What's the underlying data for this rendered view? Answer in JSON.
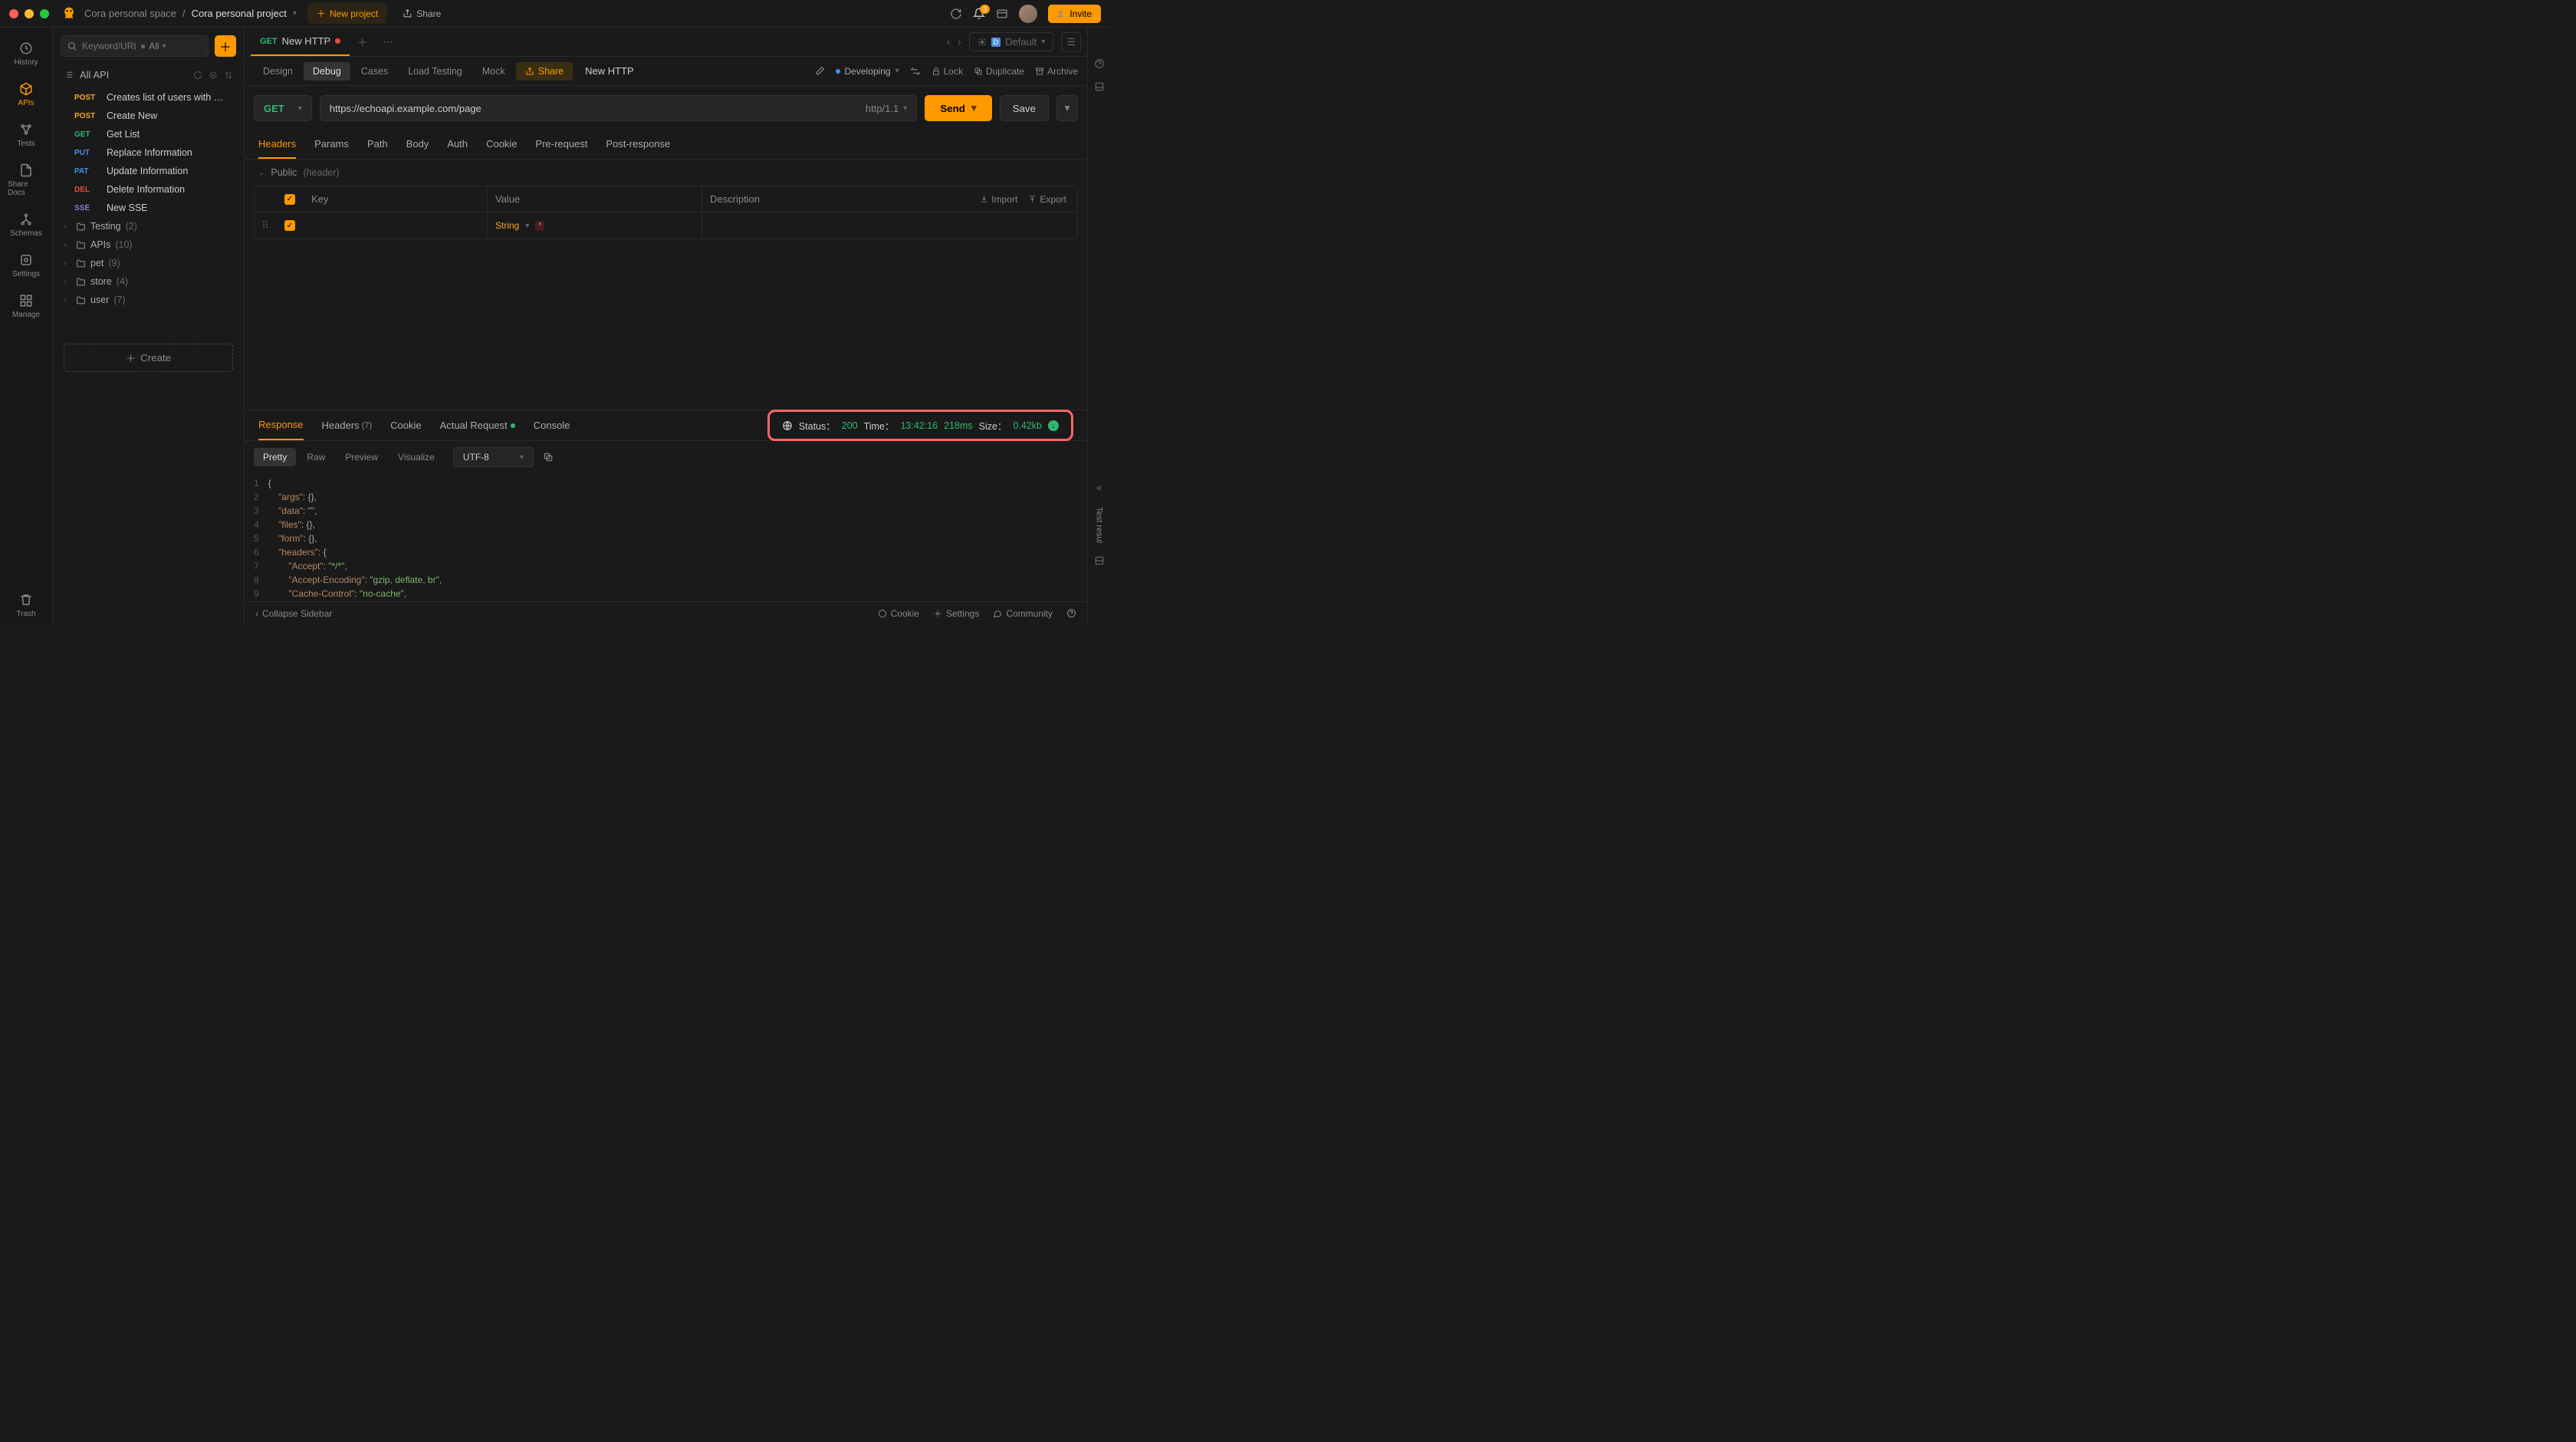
{
  "titlebar": {
    "space": "Cora personal space",
    "project": "Cora personal project",
    "new_project": "New project",
    "share": "Share",
    "invite": "Invite",
    "notification_count": "3"
  },
  "rail": {
    "history": "History",
    "apis": "APIs",
    "tests": "Tests",
    "share_docs": "Share Docs",
    "schemas": "Schemas",
    "settings": "Settings",
    "manage": "Manage",
    "trash": "Trash"
  },
  "sidebar": {
    "search_placeholder": "Keyword/URL",
    "scope": "All",
    "all_api": "All API",
    "create": "Create",
    "apis": [
      {
        "method": "POST",
        "cls": "m-post",
        "name": "Creates list of users with …"
      },
      {
        "method": "POST",
        "cls": "m-post",
        "name": "Create New"
      },
      {
        "method": "GET",
        "cls": "m-get",
        "name": "Get List"
      },
      {
        "method": "PUT",
        "cls": "m-put",
        "name": "Replace Information"
      },
      {
        "method": "PAT",
        "cls": "m-pat",
        "name": "Update Information"
      },
      {
        "method": "DEL",
        "cls": "m-del",
        "name": "Delete Information"
      },
      {
        "method": "SSE",
        "cls": "m-sse",
        "name": "New SSE"
      }
    ],
    "folders": [
      {
        "name": "Testing",
        "count": "(2)"
      },
      {
        "name": "APIs",
        "count": "(10)"
      },
      {
        "name": "pet",
        "count": "(9)"
      },
      {
        "name": "store",
        "count": "(4)"
      },
      {
        "name": "user",
        "count": "(7)"
      }
    ]
  },
  "tab": {
    "method": "GET",
    "name": "New HTTP"
  },
  "env": {
    "label": "Default",
    "badge": "D"
  },
  "modes": {
    "design": "Design",
    "debug": "Debug",
    "cases": "Cases",
    "load": "Load Testing",
    "mock": "Mock",
    "share": "Share",
    "name": "New HTTP",
    "status": "Developing",
    "lock": "Lock",
    "duplicate": "Duplicate",
    "archive": "Archive"
  },
  "request": {
    "method": "GET",
    "url": "https://echoapi.example.com/page",
    "http_version": "http/1.1",
    "send": "Send",
    "save": "Save",
    "tabs": {
      "headers": "Headers",
      "params": "Params",
      "path": "Path",
      "body": "Body",
      "auth": "Auth",
      "cookie": "Cookie",
      "pre": "Pre-request",
      "post": "Post-response"
    },
    "public_label": "Public",
    "public_sub": "(header)",
    "cols": {
      "key": "Key",
      "value": "Value",
      "desc": "Description"
    },
    "import": "Import",
    "export": "Export",
    "type_label": "String"
  },
  "response": {
    "tabs": {
      "response": "Response",
      "headers": "Headers",
      "headers_count": "(7)",
      "cookie": "Cookie",
      "actual": "Actual Request",
      "console": "Console"
    },
    "status_label": "Status：",
    "status_code": "200",
    "time_label": "Time：",
    "time_stamp": "13:42:16",
    "time_ms": "218ms",
    "size_label": "Size：",
    "size_val": "0.42kb",
    "views": {
      "pretty": "Pretty",
      "raw": "Raw",
      "preview": "Preview",
      "visualize": "Visualize"
    },
    "encoding": "UTF-8",
    "side_label": "Test resul",
    "body_lines": [
      [
        [
          "p",
          "{"
        ]
      ],
      [
        [
          "p",
          "    "
        ],
        [
          "k",
          "\"args\""
        ],
        [
          "p",
          ": {},"
        ]
      ],
      [
        [
          "p",
          "    "
        ],
        [
          "k",
          "\"data\""
        ],
        [
          "p",
          ": "
        ],
        [
          "s",
          "\"\""
        ],
        [
          "p",
          ","
        ]
      ],
      [
        [
          "p",
          "    "
        ],
        [
          "k",
          "\"files\""
        ],
        [
          "p",
          ": {},"
        ]
      ],
      [
        [
          "p",
          "    "
        ],
        [
          "k",
          "\"form\""
        ],
        [
          "p",
          ": {},"
        ]
      ],
      [
        [
          "p",
          "    "
        ],
        [
          "k",
          "\"headers\""
        ],
        [
          "p",
          ": {"
        ]
      ],
      [
        [
          "p",
          "        "
        ],
        [
          "k",
          "\"Accept\""
        ],
        [
          "p",
          ": "
        ],
        [
          "s",
          "\"*/*\""
        ],
        [
          "p",
          ","
        ]
      ],
      [
        [
          "p",
          "        "
        ],
        [
          "k",
          "\"Accept-Encoding\""
        ],
        [
          "p",
          ": "
        ],
        [
          "s",
          "\"gzip, deflate, br\""
        ],
        [
          "p",
          ","
        ]
      ],
      [
        [
          "p",
          "        "
        ],
        [
          "k",
          "\"Cache-Control\""
        ],
        [
          "p",
          ": "
        ],
        [
          "s",
          "\"no-cache\""
        ],
        [
          "p",
          ","
        ]
      ]
    ]
  },
  "footer": {
    "collapse": "Collapse Sidebar",
    "cookie": "Cookie",
    "settings": "Settings",
    "community": "Community"
  }
}
